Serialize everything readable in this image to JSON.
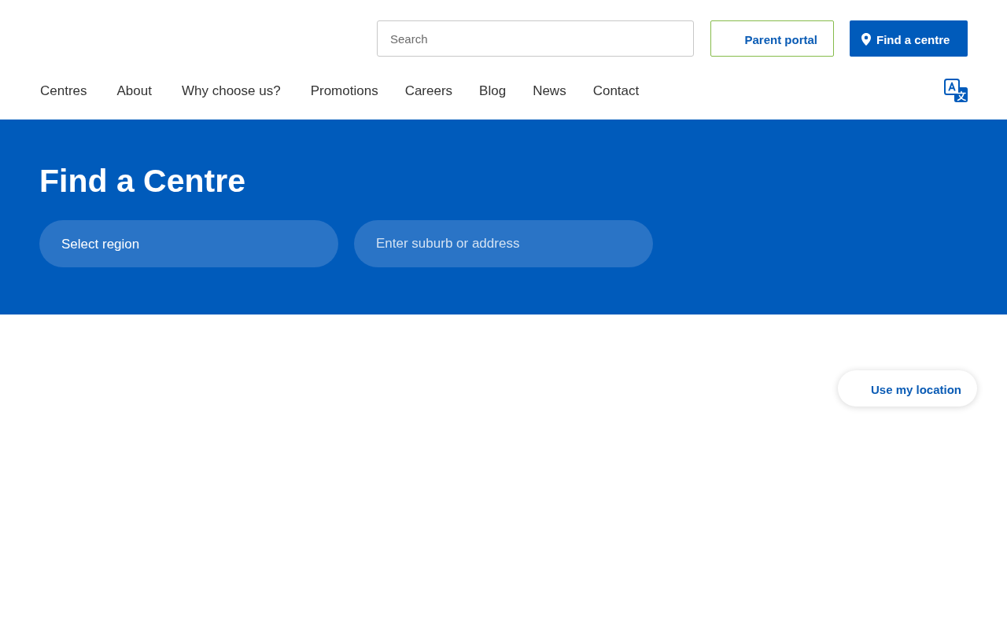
{
  "header": {
    "search": {
      "placeholder": "Search"
    },
    "buttons": [
      {
        "kind": "outline",
        "label": "Parent portal"
      },
      {
        "kind": "primary",
        "label": "Find a centre"
      }
    ]
  },
  "nav": {
    "items": [
      "Centres",
      "About",
      "Why choose us?",
      "Promotions",
      "Careers",
      "Blog",
      "News",
      "Contact"
    ]
  },
  "hero": {
    "title": "Find a Centre",
    "region_select": {
      "value": "Select region"
    },
    "address_field": {
      "placeholder": "Enter suburb or address"
    }
  },
  "map": {
    "location_button": {
      "label": "Use my location"
    }
  }
}
